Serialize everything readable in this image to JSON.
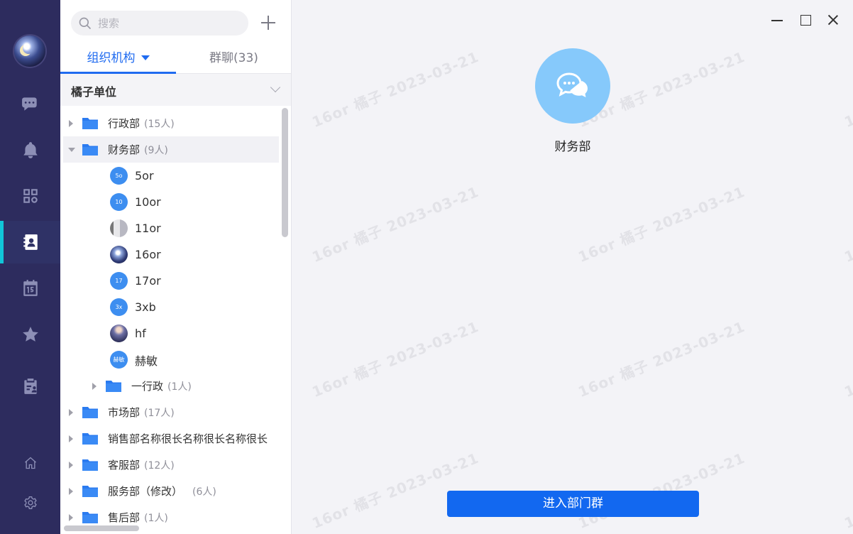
{
  "search": {
    "placeholder": "搜索"
  },
  "tabs": [
    {
      "label": "组织机构"
    },
    {
      "label": "群聊(33)"
    }
  ],
  "org": {
    "title": "橘子单位"
  },
  "departments": [
    {
      "name": "行政部",
      "count": "(15人)"
    },
    {
      "name": "财务部",
      "count": "(9人)"
    },
    {
      "name": "市场部",
      "count": "(17人)"
    },
    {
      "name": "销售部名称很长名称很长名称很长",
      "count": ""
    },
    {
      "name": "客服部",
      "count": "(12人)"
    },
    {
      "name": "服务部（修改）",
      "count": "(6人)"
    },
    {
      "name": "售后部",
      "count": "(1人)"
    }
  ],
  "members": [
    {
      "name": "5or",
      "avatar_text": "5o"
    },
    {
      "name": "10or",
      "avatar_text": "10"
    },
    {
      "name": "11or",
      "avatar_text": ""
    },
    {
      "name": "16or",
      "avatar_text": ""
    },
    {
      "name": "17or",
      "avatar_text": "17"
    },
    {
      "name": "3xb",
      "avatar_text": "3x"
    },
    {
      "name": "hf",
      "avatar_text": ""
    },
    {
      "name": "赫敏",
      "avatar_text": "赫敏"
    }
  ],
  "subdept": {
    "name": "一行政",
    "count": "(1人)"
  },
  "detail": {
    "group_name": "财务部",
    "enter_button": "进入部门群"
  },
  "watermark": {
    "text": "16or 橘子 2023-03-21"
  },
  "colors": {
    "rail": "#2d2c5e",
    "accent": "#1f6bf0",
    "active_indicator": "#11c6d8",
    "button": "#1268f0",
    "group_avatar": "#86c9fb"
  }
}
